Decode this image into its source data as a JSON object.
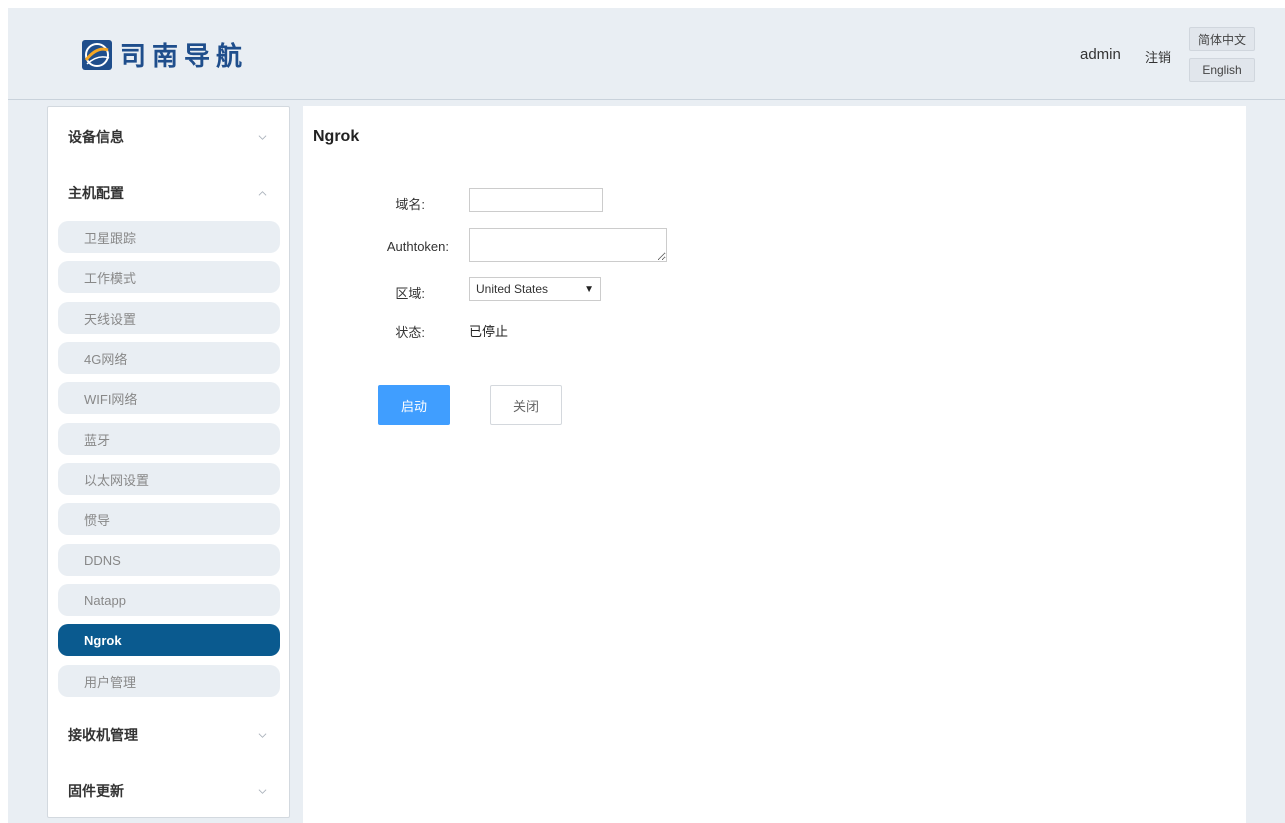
{
  "header": {
    "logo_text": "司南导航",
    "username": "admin",
    "logout_label": "注销",
    "lang_zh_label": "简体中文",
    "lang_en_label": "English"
  },
  "sidebar": {
    "groups": [
      {
        "label": "设备信息",
        "expanded": false
      },
      {
        "label": "主机配置",
        "expanded": true
      },
      {
        "label": "接收机管理",
        "expanded": false
      },
      {
        "label": "固件更新",
        "expanded": false
      }
    ],
    "sub_items": [
      {
        "label": "卫星跟踪"
      },
      {
        "label": "工作模式"
      },
      {
        "label": "天线设置"
      },
      {
        "label": "4G网络"
      },
      {
        "label": "WIFI网络"
      },
      {
        "label": "蓝牙"
      },
      {
        "label": "以太网设置"
      },
      {
        "label": "惯导"
      },
      {
        "label": "DDNS"
      },
      {
        "label": "Natapp"
      },
      {
        "label": "Ngrok",
        "active": true
      },
      {
        "label": "用户管理"
      }
    ]
  },
  "main": {
    "title": "Ngrok",
    "form": {
      "domain_label": "域名:",
      "domain_value": "",
      "token_label": "Authtoken:",
      "token_value": "",
      "region_label": "区域:",
      "region_value": "United States",
      "status_label": "状态:",
      "status_value": "已停止"
    },
    "buttons": {
      "start_label": "启动",
      "close_label": "关闭"
    }
  },
  "colors": {
    "brand": "#1f4e8c",
    "active_menu": "#0a5a8f",
    "primary_button": "#409eff",
    "background": "#e9eef3"
  }
}
